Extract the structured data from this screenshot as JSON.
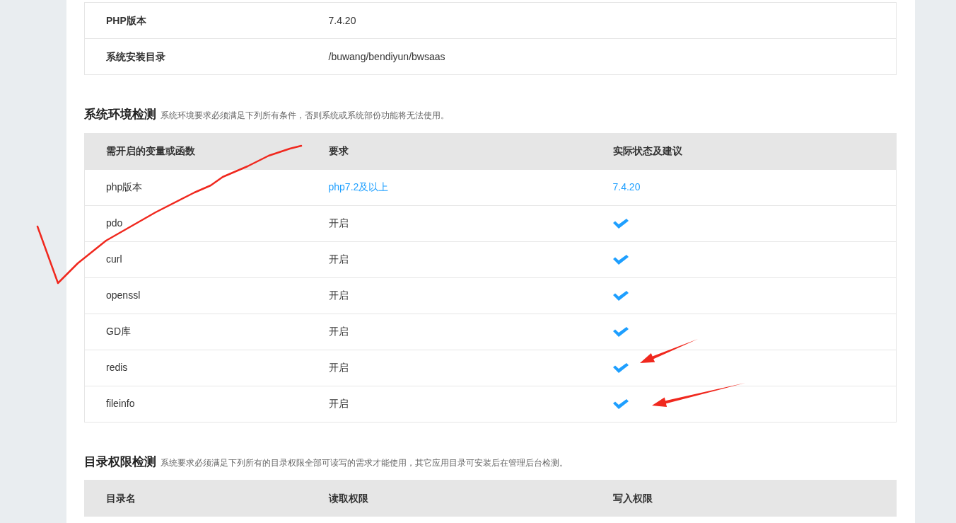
{
  "system_info": {
    "rows": [
      {
        "label": "PHP版本",
        "value": "7.4.20"
      },
      {
        "label": "系统安装目录",
        "value": "/buwang/bendiyun/bwsaas"
      }
    ]
  },
  "environment_check": {
    "title": "系统环境检测",
    "description": "系统环境要求必须满足下列所有条件，否则系统或系统部份功能将无法使用。",
    "columns": [
      "需开启的变量或函数",
      "要求",
      "实际状态及建议"
    ],
    "rows": [
      {
        "name": "php版本",
        "requirement": "php7.2及以上",
        "highlighted": true,
        "status": {
          "kind": "text",
          "text": "7.4.20"
        }
      },
      {
        "name": "pdo",
        "requirement": "开启",
        "highlighted": false,
        "status": {
          "kind": "check"
        }
      },
      {
        "name": "curl",
        "requirement": "开启",
        "highlighted": false,
        "status": {
          "kind": "check"
        }
      },
      {
        "name": "openssl",
        "requirement": "开启",
        "highlighted": false,
        "status": {
          "kind": "check"
        }
      },
      {
        "name": "GD库",
        "requirement": "开启",
        "highlighted": false,
        "status": {
          "kind": "check"
        }
      },
      {
        "name": "redis",
        "requirement": "开启",
        "highlighted": false,
        "status": {
          "kind": "check"
        }
      },
      {
        "name": "fileinfo",
        "requirement": "开启",
        "highlighted": false,
        "status": {
          "kind": "check"
        }
      }
    ]
  },
  "directory_check": {
    "title": "目录权限检测",
    "description": "系统要求必须满足下列所有的目录权限全部可读写的需求才能使用，其它应用目录可安装后在管理后台检测。",
    "columns": [
      "目录名",
      "读取权限",
      "写入权限"
    ]
  },
  "annotations": [
    {
      "kind": "tick"
    },
    {
      "kind": "arrow"
    },
    {
      "kind": "arrow"
    }
  ]
}
